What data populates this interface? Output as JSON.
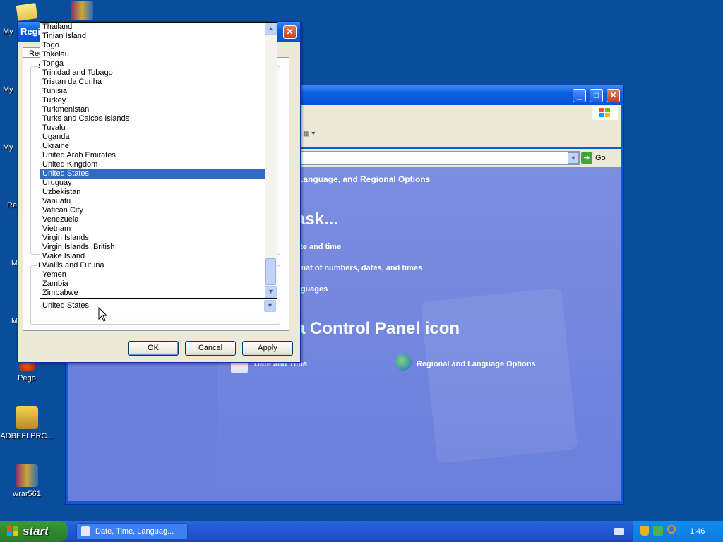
{
  "desktop": {
    "icons": [
      {
        "label": "Pego"
      },
      {
        "label": "ADBEFLPRC..."
      },
      {
        "label": "wrar561"
      }
    ],
    "edge_labels": [
      "My",
      "My",
      "My",
      "Re",
      "M",
      "M"
    ]
  },
  "control_panel": {
    "breadcrumb_text": "Language, and Regional Options",
    "go_label": "Go",
    "task_heading": "ask...",
    "tasks": [
      "ate and time",
      "rmat of numbers, dates, and times",
      "nguages"
    ],
    "icon_heading": "a Control Panel icon",
    "icons": [
      "Date and Time",
      "Regional and Language Options"
    ]
  },
  "dialog": {
    "title": "Regi",
    "tab_label": "Reg",
    "group_label_1": "S",
    "group_label_2": "L",
    "countries": [
      "Thailand",
      "Tinian Island",
      "Togo",
      "Tokelau",
      "Tonga",
      "Trinidad and Tobago",
      "Tristan da Cunha",
      "Tunisia",
      "Turkey",
      "Turkmenistan",
      "Turks and Caicos Islands",
      "Tuvalu",
      "Uganda",
      "Ukraine",
      "United Arab Emirates",
      "United Kingdom",
      "United States",
      "Uruguay",
      "Uzbekistan",
      "Vanuatu",
      "Vatican City",
      "Venezuela",
      "Vietnam",
      "Virgin Islands",
      "Virgin Islands, British",
      "Wake Island",
      "Wallis and Futuna",
      "Yemen",
      "Zambia",
      "Zimbabwe"
    ],
    "selected_country": "United States",
    "combo_value": "United States",
    "ok_label": "OK",
    "cancel_label": "Cancel",
    "apply_label": "Apply"
  },
  "taskbar": {
    "start_label": "start",
    "task_label": "Date, Time, Languag...",
    "clock": "1:46"
  }
}
